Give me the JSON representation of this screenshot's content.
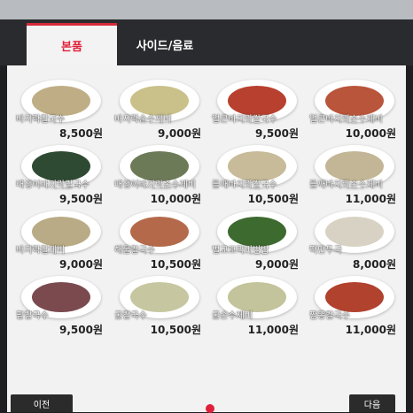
{
  "tabs": [
    {
      "label": "본품",
      "active": true
    },
    {
      "label": "사이드/음료",
      "active": false
    }
  ],
  "menu": [
    {
      "name": "바지락칼국수",
      "price": "8,500원",
      "food_color": "#bfae85"
    },
    {
      "name": "바지락손수제비",
      "price": "9,000원",
      "food_color": "#c9c08a"
    },
    {
      "name": "얼큰바지락칼국수",
      "price": "9,500원",
      "food_color": "#b8402e"
    },
    {
      "name": "얼큰바지락손수제비",
      "price": "10,000원",
      "food_color": "#b9553a"
    },
    {
      "name": "매생이바지락칼국수",
      "price": "9,500원",
      "food_color": "#2f4a32"
    },
    {
      "name": "매생이바지락손수제비",
      "price": "10,000원",
      "food_color": "#6d7a58"
    },
    {
      "name": "들깨바지락칼국수",
      "price": "10,500원",
      "food_color": "#c7bb9a"
    },
    {
      "name": "들깨바지락손수제비",
      "price": "11,000원",
      "food_color": "#c2b696"
    },
    {
      "name": "바지락칼제비",
      "price": "9,000원",
      "food_color": "#b9ab85"
    },
    {
      "name": "해물칼국수",
      "price": "10,500원",
      "food_color": "#b46a4a"
    },
    {
      "name": "벌교꼬막비빔밥",
      "price": "9,000원",
      "food_color": "#3d6a2e"
    },
    {
      "name": "떡만두국",
      "price": "8,000원",
      "food_color": "#d8d2c4"
    },
    {
      "name": "팥칼국수",
      "price": "9,500원",
      "food_color": "#7a4a4e"
    },
    {
      "name": "굴칼국수",
      "price": "10,500원",
      "food_color": "#c6c7a0"
    },
    {
      "name": "굴손수제비",
      "price": "11,000원",
      "food_color": "#c3c39c"
    },
    {
      "name": "짬뽕칼국수",
      "price": "11,000원",
      "food_color": "#b1422e"
    }
  ],
  "nav": {
    "prev_label": "이전",
    "next_label": "다음"
  }
}
